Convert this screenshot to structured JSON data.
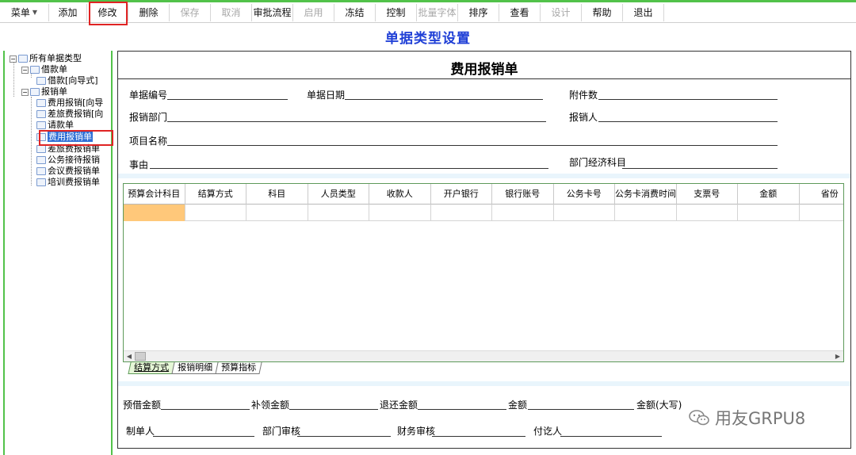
{
  "toolbar": {
    "items": [
      {
        "label": "菜单",
        "disabled": false
      },
      {
        "label": "添加",
        "disabled": false
      },
      {
        "label": "修改",
        "disabled": false
      },
      {
        "label": "删除",
        "disabled": false
      },
      {
        "label": "保存",
        "disabled": true
      },
      {
        "label": "取消",
        "disabled": true
      },
      {
        "label": "审批流程",
        "disabled": false
      },
      {
        "label": "启用",
        "disabled": true
      },
      {
        "label": "冻结",
        "disabled": false
      },
      {
        "label": "控制",
        "disabled": false
      },
      {
        "label": "批量字体",
        "disabled": true
      },
      {
        "label": "排序",
        "disabled": false
      },
      {
        "label": "查看",
        "disabled": false
      },
      {
        "label": "设计",
        "disabled": true
      },
      {
        "label": "帮助",
        "disabled": false
      },
      {
        "label": "退出",
        "disabled": false
      }
    ]
  },
  "page_title": "单据类型设置",
  "tree": {
    "root": "所有单据类型",
    "groups": [
      {
        "label": "借款单",
        "children": [
          "借款[向导式]"
        ]
      },
      {
        "label": "报销单",
        "children": [
          "费用报销[向导",
          "差旅费报销[向",
          "请款单",
          "费用报销单",
          "差旅费报销单",
          "公务接待报销",
          "会议费报销单",
          "培训费报销单"
        ]
      }
    ],
    "selected": "费用报销单"
  },
  "form": {
    "title": "费用报销单",
    "fields": {
      "doc_no": "单据编号",
      "doc_date": "单据日期",
      "attachments": "附件数",
      "department": "报销部门",
      "claimant": "报销人",
      "project": "项目名称",
      "reason": "事由",
      "dept_account": "部门经济科目"
    },
    "grid_columns": [
      "预算会计科目",
      "结算方式",
      "科目",
      "人员类型",
      "收款人",
      "开户银行",
      "银行账号",
      "公务卡号",
      "公务卡消费时间",
      "支票号",
      "金额",
      "省份"
    ],
    "tabs": [
      "结算方式",
      "报销明细",
      "预算指标"
    ],
    "active_tab": "结算方式",
    "footer_row1": {
      "advance": "预借金额",
      "supplement": "补领金额",
      "refund": "退还金额",
      "amount": "金额",
      "amount_upper": "金额(大写)"
    },
    "footer_row2": {
      "maker": "制单人",
      "dept_review": "部门审核",
      "finance_review": "财务审核",
      "payee_sign": "付讫人"
    }
  },
  "watermark": "用友GRPU8",
  "colors": {
    "accent_green": "#52c24a",
    "title_blue": "#1f3fd6",
    "highlight_red": "#e02424",
    "selected_blue": "#2f6fd6",
    "active_cell": "#ffc87a"
  }
}
